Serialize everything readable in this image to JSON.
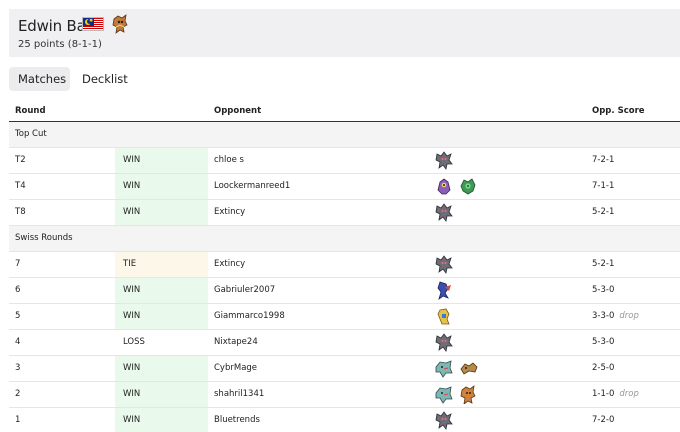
{
  "player": {
    "name": "Edwin Bak",
    "points": "25 points (8-1-1)",
    "flag_icon": "malaysia-flag-icon",
    "sprite_icon": "pokemon-sprite-icon"
  },
  "tabs": [
    {
      "label": "Matches",
      "active": true
    },
    {
      "label": "Decklist",
      "active": false
    }
  ],
  "table": {
    "columns": [
      "Round",
      "",
      "Opponent",
      "",
      "Opp. Score"
    ],
    "sections": [
      {
        "label": "Top Cut",
        "rows": [
          {
            "round": "T2",
            "result": "WIN",
            "opponent": "chloe s",
            "score": "7-2-1",
            "drop": ""
          },
          {
            "round": "T4",
            "result": "WIN",
            "opponent": "Loockermanreed1",
            "score": "7-1-1",
            "drop": ""
          },
          {
            "round": "T8",
            "result": "WIN",
            "opponent": "Extincy",
            "score": "5-2-1",
            "drop": ""
          }
        ]
      },
      {
        "label": "Swiss Rounds",
        "rows": [
          {
            "round": "7",
            "result": "TIE",
            "opponent": "Extincy",
            "score": "5-2-1",
            "drop": ""
          },
          {
            "round": "6",
            "result": "WIN",
            "opponent": "Gabriuler2007",
            "score": "5-3-0",
            "drop": ""
          },
          {
            "round": "5",
            "result": "WIN",
            "opponent": "Giammarco1998",
            "score": "3-3-0",
            "drop": "drop"
          },
          {
            "round": "4",
            "result": "LOSS",
            "opponent": "Nixtape24",
            "score": "5-3-0",
            "drop": ""
          },
          {
            "round": "3",
            "result": "WIN",
            "opponent": "CybrMage",
            "score": "2-5-0",
            "drop": ""
          },
          {
            "round": "2",
            "result": "WIN",
            "opponent": "shahril1341",
            "score": "1-1-0",
            "drop": "drop"
          },
          {
            "round": "1",
            "result": "WIN",
            "opponent": "Bluetrends",
            "score": "7-2-0",
            "drop": ""
          }
        ]
      }
    ]
  },
  "colors": {
    "win_bg": "#e9f9ec",
    "tie_bg": "#fdf7ea",
    "section_bg": "#f4f4f4",
    "header_bg": "#f0f0f3"
  }
}
